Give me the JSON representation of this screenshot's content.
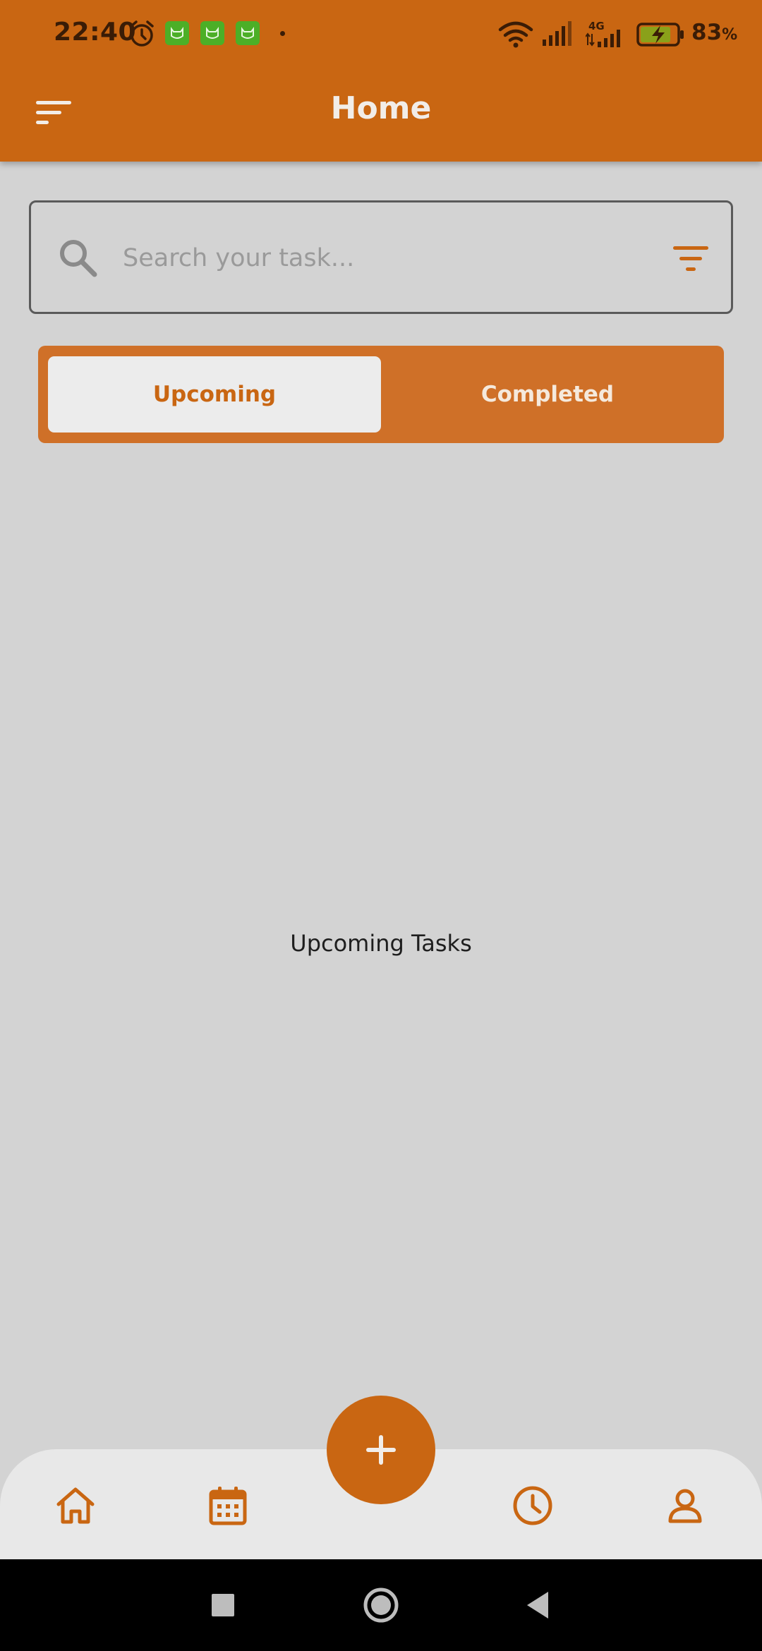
{
  "status_bar": {
    "time": "22:40",
    "battery_percent": "83",
    "battery_unit": "%",
    "network_label": "4G",
    "icons": [
      "alarm-icon",
      "app-notification-icon",
      "app-notification-icon",
      "app-notification-icon",
      "dot-icon",
      "wifi-icon",
      "signal-icon",
      "signal-4g-icon",
      "battery-charging-icon"
    ]
  },
  "app_bar": {
    "title": "Home",
    "menu_icon": "menu-icon"
  },
  "search": {
    "placeholder": "Search your task...",
    "value": "",
    "search_icon": "search-icon",
    "filter_icon": "filter-icon"
  },
  "tabs": [
    {
      "label": "Upcoming",
      "selected": true
    },
    {
      "label": "Completed",
      "selected": false
    }
  ],
  "main": {
    "message": "Upcoming Tasks"
  },
  "bottom_nav": {
    "items": [
      "home-icon",
      "calendar-icon",
      "clock-icon",
      "profile-icon"
    ],
    "fab_icon": "plus-icon"
  },
  "system_nav": {
    "items": [
      "recents-icon",
      "home-circle-icon",
      "back-icon"
    ]
  },
  "colors": {
    "primary": "#c96612",
    "tab_bar": "#cf7028",
    "background": "#d3d3d3",
    "nav_background": "#e8e8e8",
    "app_icon_green": "#4caf27"
  }
}
